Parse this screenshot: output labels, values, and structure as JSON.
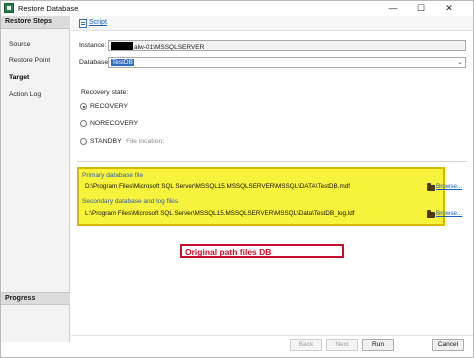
{
  "window": {
    "title": "Restore Database",
    "controls": {
      "minimize": "—",
      "maximize": "☐",
      "close": "✕"
    }
  },
  "sidebar": {
    "header": "Restore Steps",
    "steps": [
      {
        "label": "Source",
        "active": false
      },
      {
        "label": "Restore Point",
        "active": false
      },
      {
        "label": "Target",
        "active": true
      },
      {
        "label": "Action Log",
        "active": false
      }
    ],
    "progress_header": "Progress"
  },
  "toolbar": {
    "script_label": "Script"
  },
  "form": {
    "instance_label": "Instance:",
    "instance_value": "alw-01\\MSSQLSERVER",
    "database_label": "Database:",
    "database_value": "TestDB",
    "recovery_label": "Recovery state:",
    "recovery_options": [
      {
        "label": "RECOVERY",
        "checked": true
      },
      {
        "label": "NORECOVERY",
        "checked": false
      },
      {
        "label": "STANDBY",
        "checked": false
      }
    ],
    "file_location_label": "File location:"
  },
  "files": {
    "primary_title": "Primary database file",
    "primary_path": "D:\\Program Files\\Microsoft SQL Server\\MSSQL15.MSSQLSERVER\\MSSQL\\DATA\\TestDB.mdf",
    "secondary_title": "Secondary database and log files",
    "secondary_path": "L:\\Program Files\\Microsoft SQL Server\\MSSQL15.MSSQLSERVER\\MSSQL\\Data\\TestDB_log.ldf",
    "browse_label": "Browse..."
  },
  "annotation": {
    "text": "Original path files DB"
  },
  "buttons": {
    "back": "Back",
    "next": "Next",
    "run": "Run",
    "cancel": "Cancel"
  },
  "colors": {
    "highlight": "#f7f23c",
    "annotation_red": "#c8102e",
    "link_blue": "#1a5fb4"
  }
}
